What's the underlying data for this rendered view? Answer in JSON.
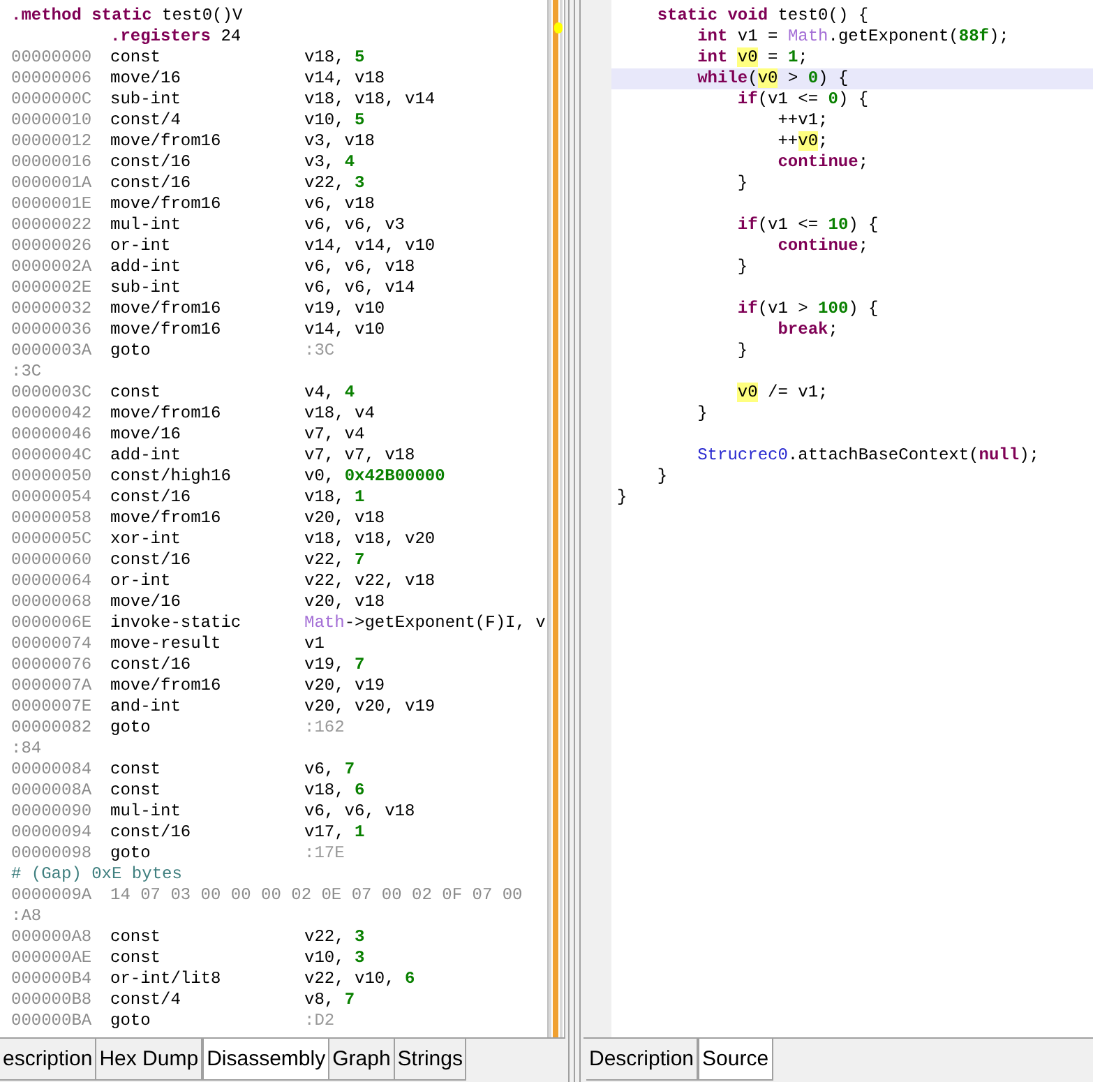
{
  "disassembly": {
    "lines": [
      {
        "kind": "header",
        "parts": [
          {
            "text": ".method static ",
            "kind": "kw"
          },
          {
            "text": "test0()V",
            "kind": "plain"
          }
        ]
      },
      {
        "kind": "directive",
        "parts": [
          {
            "text": ".registers ",
            "kind": "kw"
          },
          {
            "text": "24",
            "kind": "plain"
          }
        ]
      },
      {
        "kind": "instr",
        "addr": "00000000",
        "op": "const",
        "args": [
          {
            "text": "v18, ",
            "kind": "plain"
          },
          {
            "text": "5",
            "kind": "num"
          }
        ]
      },
      {
        "kind": "instr",
        "addr": "00000006",
        "op": "move/16",
        "args": [
          {
            "text": "v14, v18",
            "kind": "plain"
          }
        ]
      },
      {
        "kind": "instr",
        "addr": "0000000C",
        "op": "sub-int",
        "args": [
          {
            "text": "v18, v18, v14",
            "kind": "plain"
          }
        ]
      },
      {
        "kind": "instr",
        "addr": "00000010",
        "op": "const/4",
        "args": [
          {
            "text": "v10, ",
            "kind": "plain"
          },
          {
            "text": "5",
            "kind": "num"
          }
        ]
      },
      {
        "kind": "instr",
        "addr": "00000012",
        "op": "move/from16",
        "args": [
          {
            "text": "v3, v18",
            "kind": "plain"
          }
        ]
      },
      {
        "kind": "instr",
        "addr": "00000016",
        "op": "const/16",
        "args": [
          {
            "text": "v3, ",
            "kind": "plain"
          },
          {
            "text": "4",
            "kind": "num"
          }
        ]
      },
      {
        "kind": "instr",
        "addr": "0000001A",
        "op": "const/16",
        "args": [
          {
            "text": "v22, ",
            "kind": "plain"
          },
          {
            "text": "3",
            "kind": "num"
          }
        ]
      },
      {
        "kind": "instr",
        "addr": "0000001E",
        "op": "move/from16",
        "args": [
          {
            "text": "v6, v18",
            "kind": "plain"
          }
        ]
      },
      {
        "kind": "instr",
        "addr": "00000022",
        "op": "mul-int",
        "args": [
          {
            "text": "v6, v6, v3",
            "kind": "plain"
          }
        ]
      },
      {
        "kind": "instr",
        "addr": "00000026",
        "op": "or-int",
        "args": [
          {
            "text": "v14, v14, v10",
            "kind": "plain"
          }
        ]
      },
      {
        "kind": "instr",
        "addr": "0000002A",
        "op": "add-int",
        "args": [
          {
            "text": "v6, v6, v18",
            "kind": "plain"
          }
        ]
      },
      {
        "kind": "instr",
        "addr": "0000002E",
        "op": "sub-int",
        "args": [
          {
            "text": "v6, v6, v14",
            "kind": "plain"
          }
        ]
      },
      {
        "kind": "instr",
        "addr": "00000032",
        "op": "move/from16",
        "args": [
          {
            "text": "v19, v10",
            "kind": "plain"
          }
        ]
      },
      {
        "kind": "instr",
        "addr": "00000036",
        "op": "move/from16",
        "args": [
          {
            "text": "v14, v10",
            "kind": "plain"
          }
        ]
      },
      {
        "kind": "instr",
        "addr": "0000003A",
        "op": "goto",
        "args": [
          {
            "text": ":3C",
            "kind": "ref"
          }
        ]
      },
      {
        "kind": "label",
        "text": ":3C"
      },
      {
        "kind": "instr",
        "addr": "0000003C",
        "op": "const",
        "args": [
          {
            "text": "v4, ",
            "kind": "plain"
          },
          {
            "text": "4",
            "kind": "num"
          }
        ]
      },
      {
        "kind": "instr",
        "addr": "00000042",
        "op": "move/from16",
        "args": [
          {
            "text": "v18, v4",
            "kind": "plain"
          }
        ]
      },
      {
        "kind": "instr",
        "addr": "00000046",
        "op": "move/16",
        "args": [
          {
            "text": "v7, v4",
            "kind": "plain"
          }
        ]
      },
      {
        "kind": "instr",
        "addr": "0000004C",
        "op": "add-int",
        "args": [
          {
            "text": "v7, v7, v18",
            "kind": "plain"
          }
        ]
      },
      {
        "kind": "instr",
        "addr": "00000050",
        "op": "const/high16",
        "args": [
          {
            "text": "v0, ",
            "kind": "plain"
          },
          {
            "text": "0x42B00000",
            "kind": "num"
          }
        ]
      },
      {
        "kind": "instr",
        "addr": "00000054",
        "op": "const/16",
        "args": [
          {
            "text": "v18, ",
            "kind": "plain"
          },
          {
            "text": "1",
            "kind": "num"
          }
        ]
      },
      {
        "kind": "instr",
        "addr": "00000058",
        "op": "move/from16",
        "args": [
          {
            "text": "v20, v18",
            "kind": "plain"
          }
        ]
      },
      {
        "kind": "instr",
        "addr": "0000005C",
        "op": "xor-int",
        "args": [
          {
            "text": "v18, v18, v20",
            "kind": "plain"
          }
        ]
      },
      {
        "kind": "instr",
        "addr": "00000060",
        "op": "const/16",
        "args": [
          {
            "text": "v22, ",
            "kind": "plain"
          },
          {
            "text": "7",
            "kind": "num"
          }
        ]
      },
      {
        "kind": "instr",
        "addr": "00000064",
        "op": "or-int",
        "args": [
          {
            "text": "v22, v22, v18",
            "kind": "plain"
          }
        ]
      },
      {
        "kind": "instr",
        "addr": "00000068",
        "op": "move/16",
        "args": [
          {
            "text": "v20, v18",
            "kind": "plain"
          }
        ]
      },
      {
        "kind": "instr",
        "addr": "0000006E",
        "op": "invoke-static",
        "args": [
          {
            "text": "Math",
            "kind": "cls"
          },
          {
            "text": "->getExponent(F)I, v",
            "kind": "plain"
          }
        ]
      },
      {
        "kind": "instr",
        "addr": "00000074",
        "op": "move-result",
        "args": [
          {
            "text": "v1",
            "kind": "plain"
          }
        ]
      },
      {
        "kind": "instr",
        "addr": "00000076",
        "op": "const/16",
        "args": [
          {
            "text": "v19, ",
            "kind": "plain"
          },
          {
            "text": "7",
            "kind": "num"
          }
        ]
      },
      {
        "kind": "instr",
        "addr": "0000007A",
        "op": "move/from16",
        "args": [
          {
            "text": "v20, v19",
            "kind": "plain"
          }
        ]
      },
      {
        "kind": "instr",
        "addr": "0000007E",
        "op": "and-int",
        "args": [
          {
            "text": "v20, v20, v19",
            "kind": "plain"
          }
        ]
      },
      {
        "kind": "instr",
        "addr": "00000082",
        "op": "goto",
        "args": [
          {
            "text": ":162",
            "kind": "ref"
          }
        ]
      },
      {
        "kind": "label",
        "text": ":84"
      },
      {
        "kind": "instr",
        "addr": "00000084",
        "op": "const",
        "args": [
          {
            "text": "v6, ",
            "kind": "plain"
          },
          {
            "text": "7",
            "kind": "num"
          }
        ]
      },
      {
        "kind": "instr",
        "addr": "0000008A",
        "op": "const",
        "args": [
          {
            "text": "v18, ",
            "kind": "plain"
          },
          {
            "text": "6",
            "kind": "num"
          }
        ]
      },
      {
        "kind": "instr",
        "addr": "00000090",
        "op": "mul-int",
        "args": [
          {
            "text": "v6, v6, v18",
            "kind": "plain"
          }
        ]
      },
      {
        "kind": "instr",
        "addr": "00000094",
        "op": "const/16",
        "args": [
          {
            "text": "v17, ",
            "kind": "plain"
          },
          {
            "text": "1",
            "kind": "num"
          }
        ]
      },
      {
        "kind": "instr",
        "addr": "00000098",
        "op": "goto",
        "args": [
          {
            "text": ":17E",
            "kind": "ref"
          }
        ]
      },
      {
        "kind": "comment",
        "text": "# (Gap) 0xE bytes"
      },
      {
        "kind": "bytes",
        "addr": "0000009A",
        "bytes": "14 07 03 00 00 00 02 0E 07 00 02 0F 07 00"
      },
      {
        "kind": "label",
        "text": ":A8"
      },
      {
        "kind": "instr",
        "addr": "000000A8",
        "op": "const",
        "args": [
          {
            "text": "v22, ",
            "kind": "plain"
          },
          {
            "text": "3",
            "kind": "num"
          }
        ]
      },
      {
        "kind": "instr",
        "addr": "000000AE",
        "op": "const",
        "args": [
          {
            "text": "v10, ",
            "kind": "plain"
          },
          {
            "text": "3",
            "kind": "num"
          }
        ]
      },
      {
        "kind": "instr",
        "addr": "000000B4",
        "op": "or-int/lit8",
        "args": [
          {
            "text": "v22, v10, ",
            "kind": "plain"
          },
          {
            "text": "6",
            "kind": "num"
          }
        ]
      },
      {
        "kind": "instr",
        "addr": "000000B8",
        "op": "const/4",
        "args": [
          {
            "text": "v8, ",
            "kind": "plain"
          },
          {
            "text": "7",
            "kind": "num"
          }
        ]
      },
      {
        "kind": "instr",
        "addr": "000000BA",
        "op": "goto",
        "args": [
          {
            "text": ":D2",
            "kind": "ref"
          }
        ]
      }
    ],
    "tabs": [
      {
        "label": "escription",
        "selected": false
      },
      {
        "label": "Hex Dump",
        "selected": false
      },
      {
        "label": "Disassembly",
        "selected": true
      },
      {
        "label": "Graph",
        "selected": false
      },
      {
        "label": "Strings",
        "selected": false
      }
    ]
  },
  "source": {
    "lines": [
      {
        "current": false,
        "parts": [
          {
            "text": "    static void",
            "kind": "kw"
          },
          {
            "text": " test0() {",
            "kind": "plain"
          }
        ]
      },
      {
        "current": false,
        "parts": [
          {
            "text": "        int",
            "kind": "kw"
          },
          {
            "text": " v1 = ",
            "kind": "plain"
          },
          {
            "text": "Math",
            "kind": "cls"
          },
          {
            "text": ".getExponent(",
            "kind": "plain"
          },
          {
            "text": "88f",
            "kind": "num"
          },
          {
            "text": ");",
            "kind": "plain"
          }
        ]
      },
      {
        "current": false,
        "parts": [
          {
            "text": "        int ",
            "kind": "kw"
          },
          {
            "text": "v0",
            "kind": "hl"
          },
          {
            "text": " = ",
            "kind": "plain"
          },
          {
            "text": "1",
            "kind": "num"
          },
          {
            "text": ";",
            "kind": "plain"
          }
        ]
      },
      {
        "current": true,
        "parts": [
          {
            "text": "        while",
            "kind": "kw"
          },
          {
            "text": "(",
            "kind": "plain"
          },
          {
            "text": "v0",
            "kind": "hl"
          },
          {
            "text": " > ",
            "kind": "plain"
          },
          {
            "text": "0",
            "kind": "num"
          },
          {
            "text": ") {",
            "kind": "plain"
          }
        ]
      },
      {
        "current": false,
        "parts": [
          {
            "text": "            if",
            "kind": "kw"
          },
          {
            "text": "(v1 <= ",
            "kind": "plain"
          },
          {
            "text": "0",
            "kind": "num"
          },
          {
            "text": ") {",
            "kind": "plain"
          }
        ]
      },
      {
        "current": false,
        "parts": [
          {
            "text": "                ++v1;",
            "kind": "plain"
          }
        ]
      },
      {
        "current": false,
        "parts": [
          {
            "text": "                ++",
            "kind": "plain"
          },
          {
            "text": "v0",
            "kind": "hl"
          },
          {
            "text": ";",
            "kind": "plain"
          }
        ]
      },
      {
        "current": false,
        "parts": [
          {
            "text": "                continue",
            "kind": "kw"
          },
          {
            "text": ";",
            "kind": "plain"
          }
        ]
      },
      {
        "current": false,
        "parts": [
          {
            "text": "            }",
            "kind": "plain"
          }
        ]
      },
      {
        "current": false
      },
      {
        "current": false,
        "parts": [
          {
            "text": "            if",
            "kind": "kw"
          },
          {
            "text": "(v1 <= ",
            "kind": "plain"
          },
          {
            "text": "10",
            "kind": "num"
          },
          {
            "text": ") {",
            "kind": "plain"
          }
        ]
      },
      {
        "current": false,
        "parts": [
          {
            "text": "                continue",
            "kind": "kw"
          },
          {
            "text": ";",
            "kind": "plain"
          }
        ]
      },
      {
        "current": false,
        "parts": [
          {
            "text": "            }",
            "kind": "plain"
          }
        ]
      },
      {
        "current": false
      },
      {
        "current": false,
        "parts": [
          {
            "text": "            if",
            "kind": "kw"
          },
          {
            "text": "(v1 > ",
            "kind": "plain"
          },
          {
            "text": "100",
            "kind": "num"
          },
          {
            "text": ") {",
            "kind": "plain"
          }
        ]
      },
      {
        "current": false,
        "parts": [
          {
            "text": "                break",
            "kind": "kw"
          },
          {
            "text": ";",
            "kind": "plain"
          }
        ]
      },
      {
        "current": false,
        "parts": [
          {
            "text": "            }",
            "kind": "plain"
          }
        ]
      },
      {
        "current": false
      },
      {
        "current": false,
        "parts": [
          {
            "text": "            v0",
            "kind": "hl"
          },
          {
            "text": " /= v1;",
            "kind": "plain"
          }
        ]
      },
      {
        "current": false,
        "parts": [
          {
            "text": "        }",
            "kind": "plain"
          }
        ]
      },
      {
        "current": false
      },
      {
        "current": false,
        "parts": [
          {
            "text": "        Strucrec0",
            "kind": "cls2"
          },
          {
            "text": ".attachBaseContext(",
            "kind": "plain"
          },
          {
            "text": "null",
            "kind": "kw"
          },
          {
            "text": ");",
            "kind": "plain"
          }
        ]
      },
      {
        "current": false,
        "parts": [
          {
            "text": "    }",
            "kind": "plain"
          }
        ]
      },
      {
        "current": false,
        "parts": [
          {
            "text": "}",
            "kind": "plain"
          }
        ]
      }
    ],
    "tabs": [
      {
        "label": "Description",
        "selected": false
      },
      {
        "label": "Source",
        "selected": true
      }
    ]
  }
}
